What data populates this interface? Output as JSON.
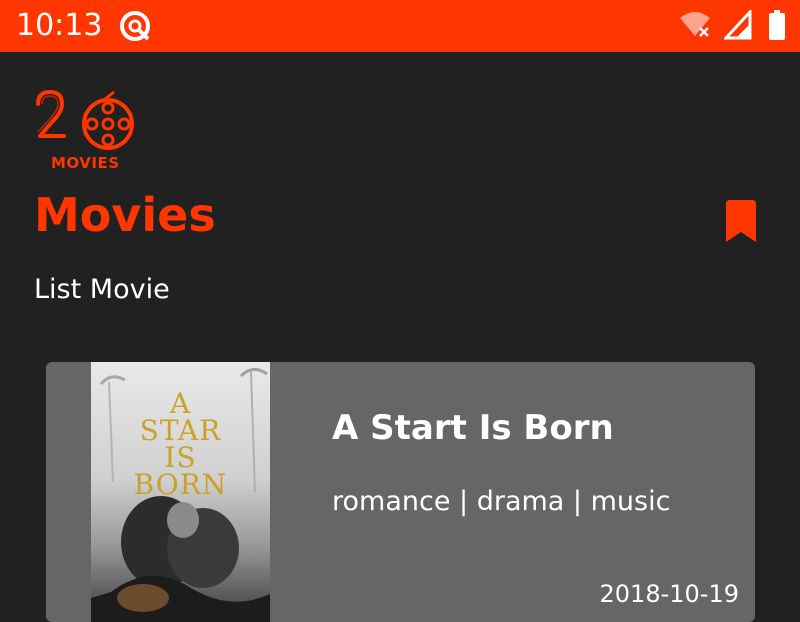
{
  "status_bar": {
    "time": "10:13",
    "app_icon": "notification-app-icon",
    "icons": [
      "wifi-off-icon",
      "cellular-signal-icon",
      "battery-icon"
    ],
    "color": "#ff3600"
  },
  "header": {
    "logo_text": "MOVIES",
    "title": "Movies",
    "subtitle": "List Movie",
    "bookmark_icon": "bookmark-icon",
    "accent_color": "#ff3600"
  },
  "movies": [
    {
      "title": "A Start Is Born",
      "genres": "romance | drama | music",
      "release_date": "2018-10-19",
      "poster_text": "A STAR IS BORN"
    }
  ]
}
